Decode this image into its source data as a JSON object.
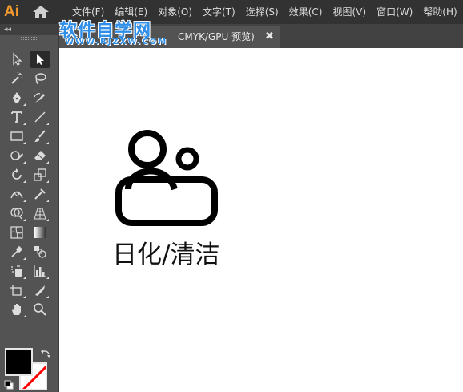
{
  "app": {
    "logo_text": "Ai"
  },
  "menu": [
    "文件(F)",
    "编辑(E)",
    "对象(O)",
    "文字(T)",
    "选择(S)",
    "效果(C)",
    "视图(V)",
    "窗口(W)",
    "帮助(H)"
  ],
  "watermark": {
    "title": "软件自学网",
    "url": "WWW.RJZXW.COM"
  },
  "document_tab": {
    "label": "CMYK/GPU 预览)",
    "close": "✖"
  },
  "toolbar": {
    "collapse": "◂◂"
  },
  "artwork": {
    "caption": "日化/清洁"
  },
  "colors": {
    "accent": "#f39a2e",
    "watermark": "#2f8ee8",
    "fill": "#000000",
    "stroke_none": "#ff0000"
  }
}
